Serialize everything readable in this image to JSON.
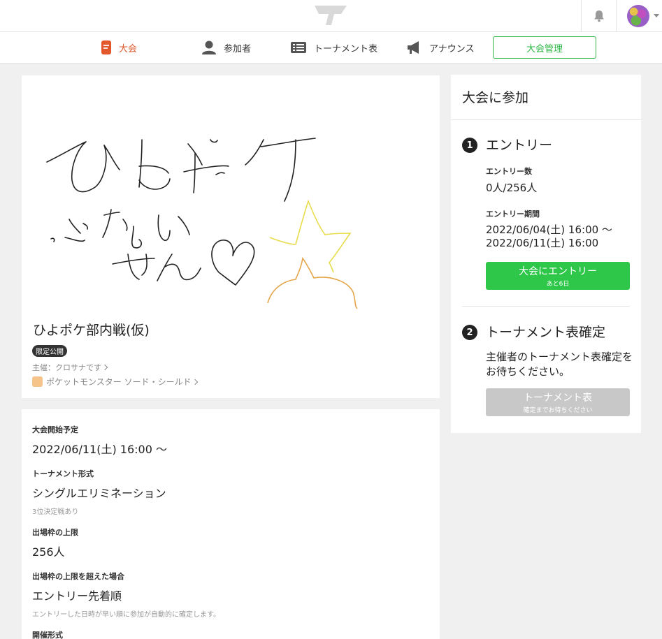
{
  "nav": {
    "tabs": [
      {
        "label": "大会",
        "active": true
      },
      {
        "label": "参加者"
      },
      {
        "label": "トーナメント表"
      },
      {
        "label": "アナウンス"
      }
    ],
    "manage_label": "大会管理"
  },
  "colors": {
    "accent": "#e2572b",
    "green": "#2ec74a",
    "disabled": "#c8c8c8"
  },
  "tournament": {
    "title": "ひよポケ部内戦(仮)",
    "visibility_badge": "限定公開",
    "organizer": "主催：クロサナです",
    "game": "ポケットモンスター ソード・シールド",
    "sketch_text": [
      "ひよポケ",
      "ぶない",
      "せん"
    ]
  },
  "details": [
    {
      "label": "大会開始予定",
      "value": "2022/06/11(土) 16:00 ～",
      "note": ""
    },
    {
      "label": "トーナメント形式",
      "value": "シングルエリミネーション",
      "note": "3位決定戦あり"
    },
    {
      "label": "出場枠の上限",
      "value": "256人",
      "note": ""
    },
    {
      "label": "出場枠の上限を超えた場合",
      "value": "エントリー先着順",
      "note": "エントリーした日時が早い順に参加が自動的に確定します。"
    },
    {
      "label": "開催形式",
      "value": "",
      "note": ""
    }
  ],
  "join": {
    "heading": "大会に参加",
    "step1": {
      "num": "1",
      "title": "エントリー",
      "count_label": "エントリー数",
      "count_value": "0人/256人",
      "period_label": "エントリー期間",
      "period_start": "2022/06/04(土) 16:00 ～",
      "period_end": "2022/06/11(土) 16:00",
      "button_main": "大会にエントリー",
      "button_sub": "あと6日"
    },
    "step2": {
      "num": "2",
      "title": "トーナメント表確定",
      "message": "主催者のトーナメント表確定をお待ちください。",
      "button_main": "トーナメント表",
      "button_sub": "確定までお待ちください"
    }
  }
}
